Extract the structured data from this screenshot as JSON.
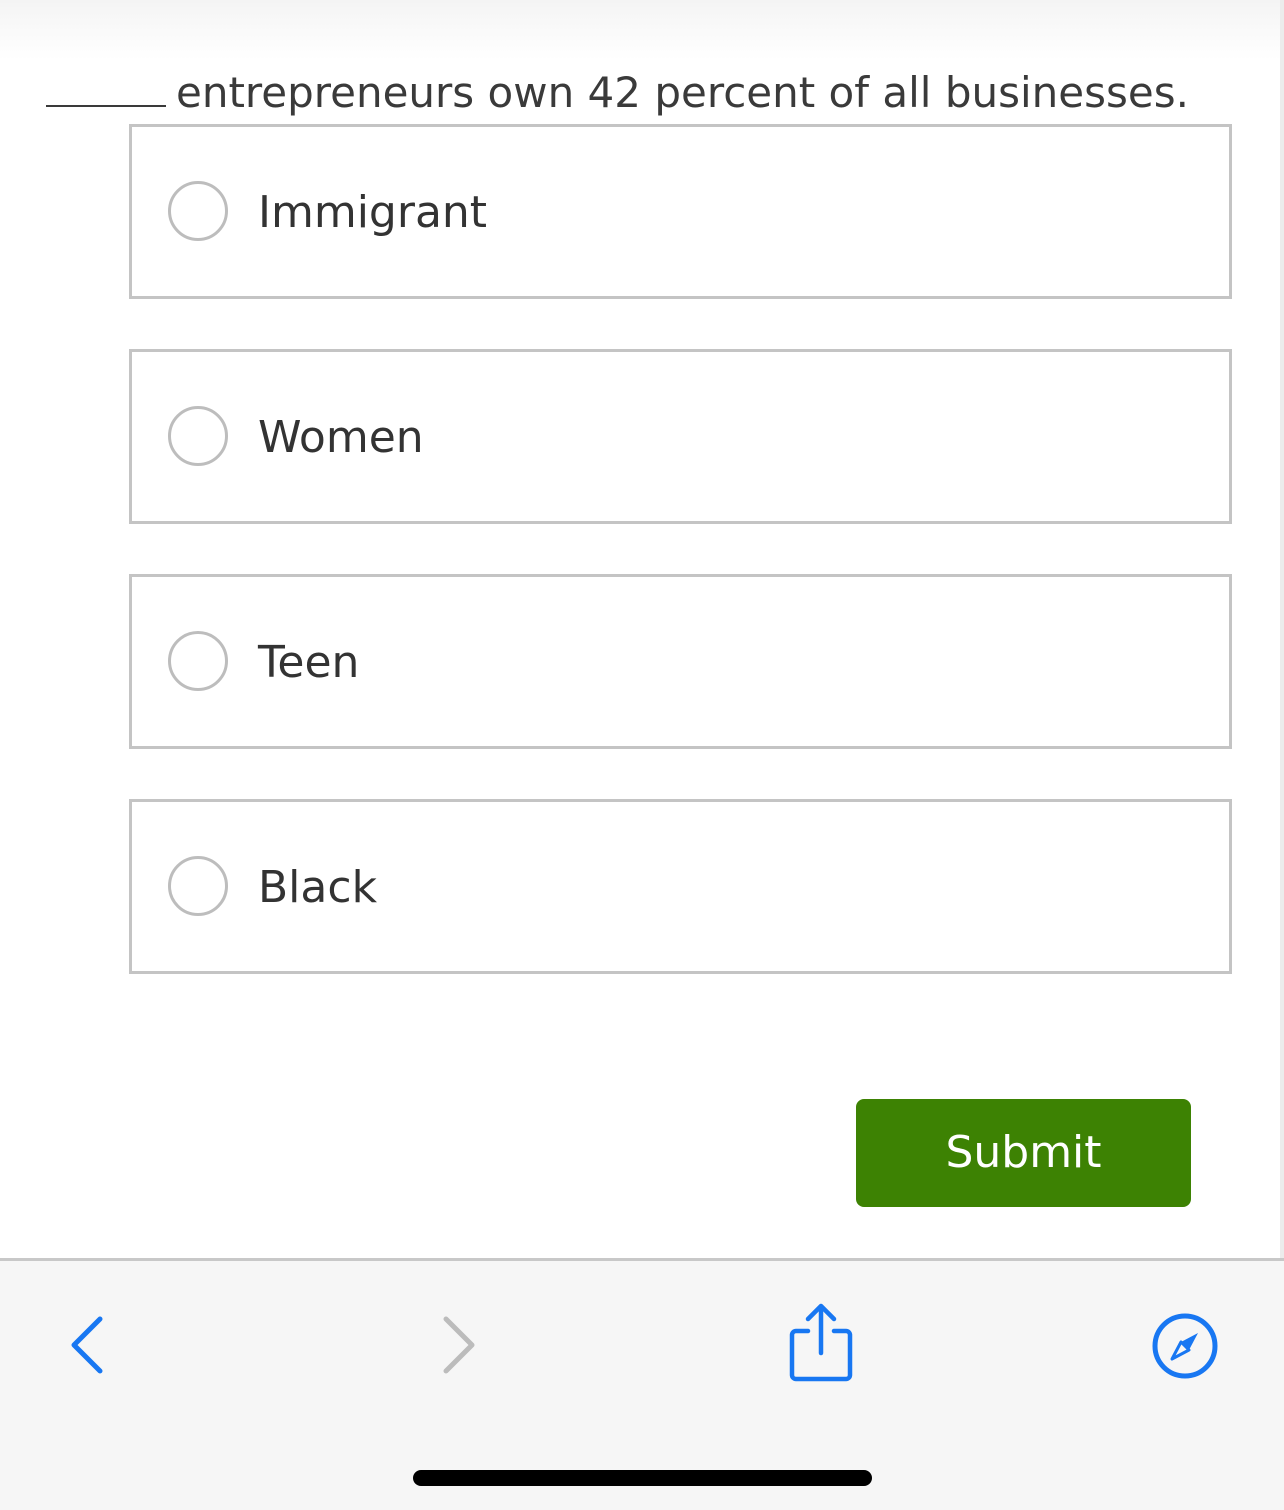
{
  "question": {
    "text": "entrepreneurs own 42 percent of all businesses."
  },
  "options": [
    {
      "label": "Immigrant",
      "selected": false
    },
    {
      "label": "Women",
      "selected": false
    },
    {
      "label": "Teen",
      "selected": false
    },
    {
      "label": "Black",
      "selected": false
    }
  ],
  "submit": {
    "label": "Submit",
    "color": "#3d8203"
  },
  "browser_toolbar": {
    "back_icon": "chevron-left-icon",
    "forward_icon": "chevron-right-icon",
    "share_icon": "share-icon",
    "compass_icon": "compass-icon",
    "accent_color": "#1877f2",
    "disabled_color": "#bcbcbc"
  }
}
